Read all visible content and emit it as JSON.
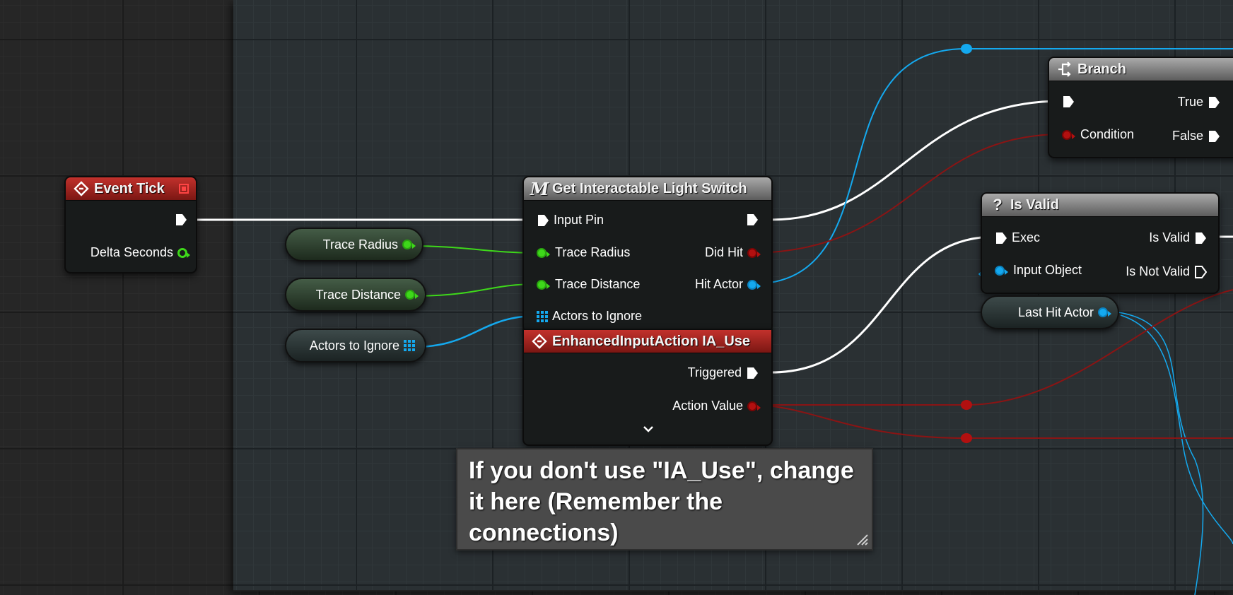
{
  "nodes": {
    "event_tick": {
      "title": "Event Tick",
      "delta_seconds": "Delta Seconds"
    },
    "get_light_switch": {
      "title": "Get Interactable Light Switch",
      "input_pin": "Input Pin",
      "trace_radius": "Trace Radius",
      "trace_distance": "Trace Distance",
      "actors_to_ignore": "Actors to Ignore",
      "did_hit": "Did Hit",
      "hit_actor": "Hit Actor"
    },
    "input_action": {
      "title": "EnhancedInputAction IA_Use",
      "triggered": "Triggered",
      "action_value": "Action Value"
    },
    "branch": {
      "title": "Branch",
      "condition": "Condition",
      "true_label": "True",
      "false_label": "False"
    },
    "is_valid": {
      "title": "Is Valid",
      "exec": "Exec",
      "input_object": "Input Object",
      "is_valid_out": "Is Valid",
      "is_not_valid_out": "Is Not Valid"
    }
  },
  "getters": {
    "trace_radius": "Trace Radius",
    "trace_distance": "Trace Distance",
    "actors_to_ignore": "Actors to Ignore",
    "last_hit_actor": "Last Hit Actor"
  },
  "comment": {
    "text": "If you don't use \"IA_Use\", change it here (Remember the connections)"
  },
  "colors": {
    "exec": "#ffffff",
    "float": "#3ed81a",
    "object": "#14a9ef",
    "bool": "#b21010",
    "event_header": "#c2312c",
    "function_header": "#a9a9a9"
  }
}
